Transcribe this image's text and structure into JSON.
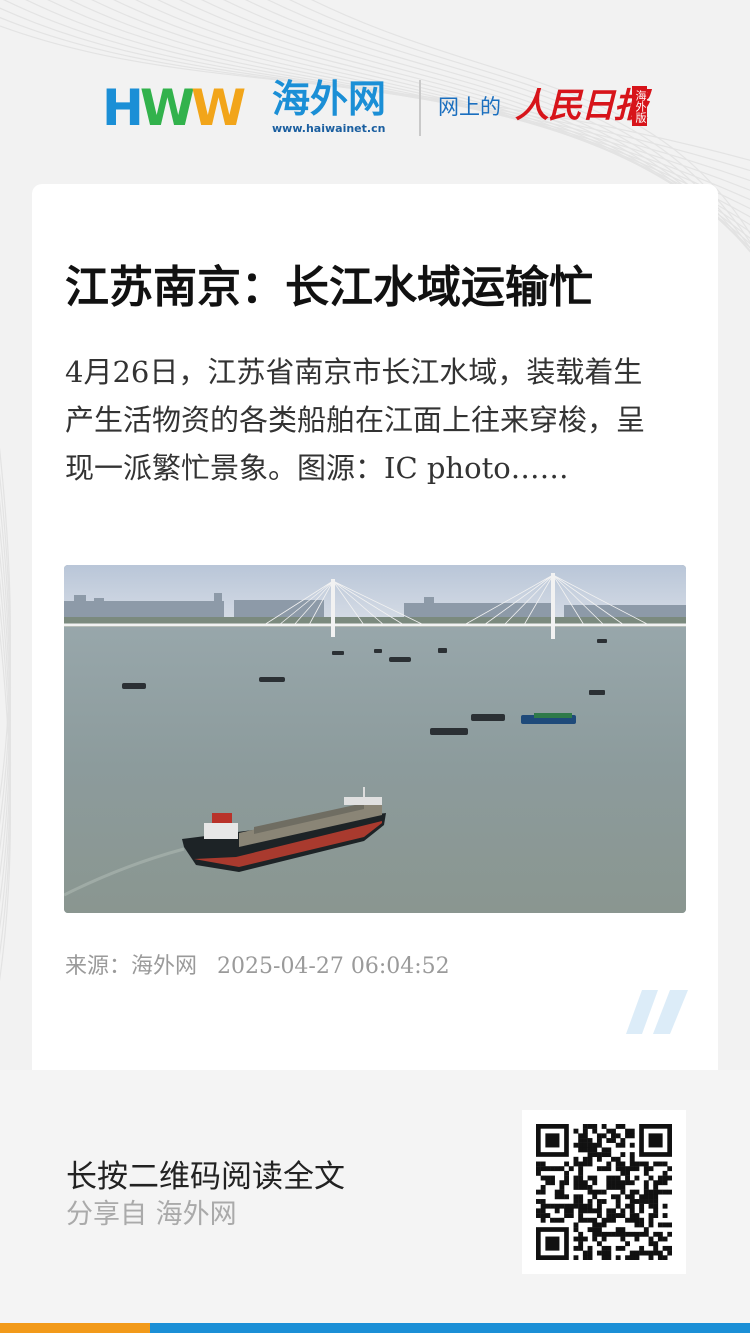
{
  "brand": {
    "logo_letters": [
      "H",
      "W",
      "W"
    ],
    "logo_name": "海外网",
    "logo_url": "www.haiwainet.cn",
    "partner_prefix": "网上的",
    "partner_name": "人民日报",
    "partner_badge": "海外版",
    "colors": {
      "blue": "#1b8fd6",
      "green": "#32b24c",
      "orange": "#f2a51a",
      "red": "#d7141a"
    }
  },
  "article": {
    "title": "江苏南京：长江水域运输忙",
    "summary": "4月26日，江苏省南京市长江水域，装载着生产生活物资的各类船舶在江面上往来穿梭，呈现一派繁忙景象。图源：IC photo……",
    "source_label": "来源：海外网",
    "datetime": "2025-04-27 06:04:52",
    "quote_icon": "double-slash-quote-icon"
  },
  "footer": {
    "cta": "长按二维码阅读全文",
    "share": "分享自 海外网",
    "qr_icon": "qr-code-icon"
  }
}
